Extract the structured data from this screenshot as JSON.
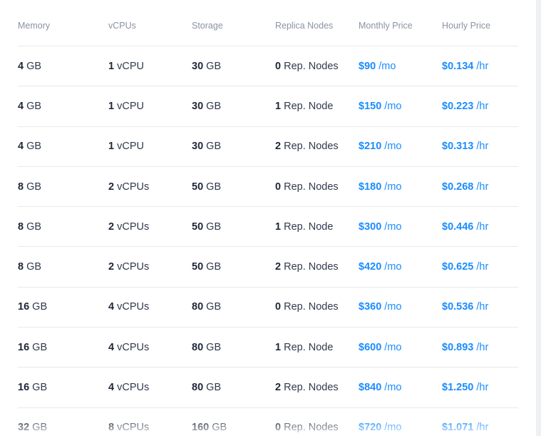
{
  "table": {
    "headers": [
      "Memory",
      "vCPUs",
      "Storage",
      "Replica Nodes",
      "Monthly Price",
      "Hourly Price"
    ],
    "rows": [
      {
        "mem_val": "4",
        "mem_unit": " GB",
        "cpu_val": "1",
        "cpu_unit": " vCPU",
        "sto_val": "30",
        "sto_unit": " GB",
        "rep_val": "0",
        "rep_unit": " Rep. Nodes",
        "mon_val": "$90",
        "mon_unit": " /mo",
        "hr_val": "$0.134",
        "hr_unit": " /hr"
      },
      {
        "mem_val": "4",
        "mem_unit": " GB",
        "cpu_val": "1",
        "cpu_unit": " vCPU",
        "sto_val": "30",
        "sto_unit": " GB",
        "rep_val": "1",
        "rep_unit": " Rep. Node",
        "mon_val": "$150",
        "mon_unit": " /mo",
        "hr_val": "$0.223",
        "hr_unit": " /hr"
      },
      {
        "mem_val": "4",
        "mem_unit": " GB",
        "cpu_val": "1",
        "cpu_unit": " vCPU",
        "sto_val": "30",
        "sto_unit": " GB",
        "rep_val": "2",
        "rep_unit": " Rep. Nodes",
        "mon_val": "$210",
        "mon_unit": " /mo",
        "hr_val": "$0.313",
        "hr_unit": " /hr"
      },
      {
        "mem_val": "8",
        "mem_unit": " GB",
        "cpu_val": "2",
        "cpu_unit": " vCPUs",
        "sto_val": "50",
        "sto_unit": " GB",
        "rep_val": "0",
        "rep_unit": " Rep. Nodes",
        "mon_val": "$180",
        "mon_unit": " /mo",
        "hr_val": "$0.268",
        "hr_unit": " /hr"
      },
      {
        "mem_val": "8",
        "mem_unit": " GB",
        "cpu_val": "2",
        "cpu_unit": " vCPUs",
        "sto_val": "50",
        "sto_unit": " GB",
        "rep_val": "1",
        "rep_unit": " Rep. Node",
        "mon_val": "$300",
        "mon_unit": " /mo",
        "hr_val": "$0.446",
        "hr_unit": " /hr"
      },
      {
        "mem_val": "8",
        "mem_unit": " GB",
        "cpu_val": "2",
        "cpu_unit": " vCPUs",
        "sto_val": "50",
        "sto_unit": " GB",
        "rep_val": "2",
        "rep_unit": " Rep. Nodes",
        "mon_val": "$420",
        "mon_unit": " /mo",
        "hr_val": "$0.625",
        "hr_unit": " /hr"
      },
      {
        "mem_val": "16",
        "mem_unit": " GB",
        "cpu_val": "4",
        "cpu_unit": " vCPUs",
        "sto_val": "80",
        "sto_unit": " GB",
        "rep_val": "0",
        "rep_unit": " Rep. Nodes",
        "mon_val": "$360",
        "mon_unit": " /mo",
        "hr_val": "$0.536",
        "hr_unit": " /hr"
      },
      {
        "mem_val": "16",
        "mem_unit": " GB",
        "cpu_val": "4",
        "cpu_unit": " vCPUs",
        "sto_val": "80",
        "sto_unit": " GB",
        "rep_val": "1",
        "rep_unit": " Rep. Node",
        "mon_val": "$600",
        "mon_unit": " /mo",
        "hr_val": "$0.893",
        "hr_unit": " /hr"
      },
      {
        "mem_val": "16",
        "mem_unit": " GB",
        "cpu_val": "4",
        "cpu_unit": " vCPUs",
        "sto_val": "80",
        "sto_unit": " GB",
        "rep_val": "2",
        "rep_unit": " Rep. Nodes",
        "mon_val": "$840",
        "mon_unit": " /mo",
        "hr_val": "$1.250",
        "hr_unit": " /hr"
      },
      {
        "mem_val": "32",
        "mem_unit": " GB",
        "cpu_val": "8",
        "cpu_unit": " vCPUs",
        "sto_val": "160",
        "sto_unit": " GB",
        "rep_val": "0",
        "rep_unit": " Rep. Nodes",
        "mon_val": "$720",
        "mon_unit": " /mo",
        "hr_val": "$1.071",
        "hr_unit": " /hr"
      }
    ]
  },
  "colors": {
    "accent": "#1a8cff",
    "text_primary": "#1e2738",
    "text_header": "#8a93a3",
    "divider": "#e7e9ee"
  }
}
